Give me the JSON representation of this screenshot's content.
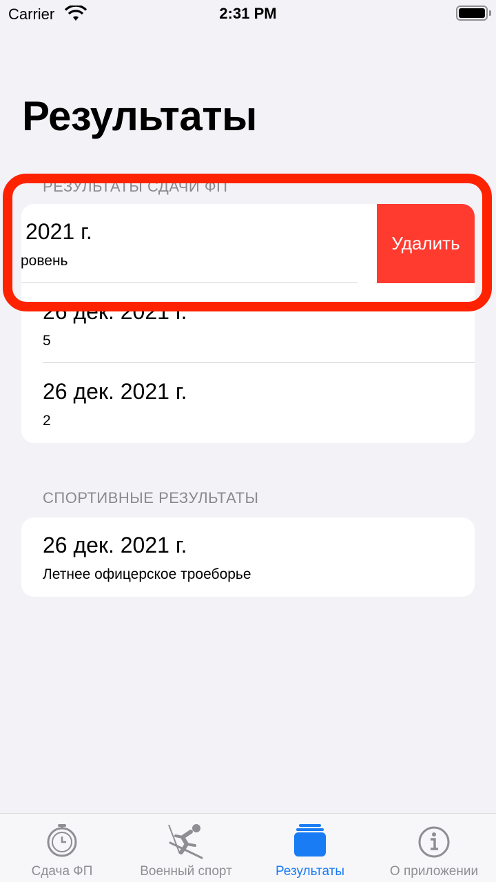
{
  "status_bar": {
    "carrier": "Carrier",
    "time": "2:31 PM"
  },
  "title": "Результаты",
  "sections": [
    {
      "header": "РЕЗУЛЬТАТЫ СДАЧИ ФП",
      "rows": [
        {
          "title": "2021 г.",
          "subtitle": "ровень",
          "swiped": true
        },
        {
          "title": "26 дек. 2021 г.",
          "subtitle": "5"
        },
        {
          "title": "26 дек. 2021 г.",
          "subtitle": "2"
        }
      ]
    },
    {
      "header": "СПОРТИВНЫЕ РЕЗУЛЬТАТЫ",
      "rows": [
        {
          "title": "26 дек. 2021 г.",
          "subtitle": "Летнее офицерское троеборье"
        }
      ]
    }
  ],
  "delete_label": "Удалить",
  "tabs": [
    {
      "label": "Сдача ФП",
      "icon": "stopwatch-icon"
    },
    {
      "label": "Военный спорт",
      "icon": "skier-icon"
    },
    {
      "label": "Результаты",
      "icon": "stack-icon",
      "active": true
    },
    {
      "label": "О приложении",
      "icon": "info-icon"
    }
  ],
  "colors": {
    "accent": "#1a7cf5",
    "delete": "#ff3b30",
    "highlight": "#ff2200",
    "background": "#f2f2f7"
  }
}
